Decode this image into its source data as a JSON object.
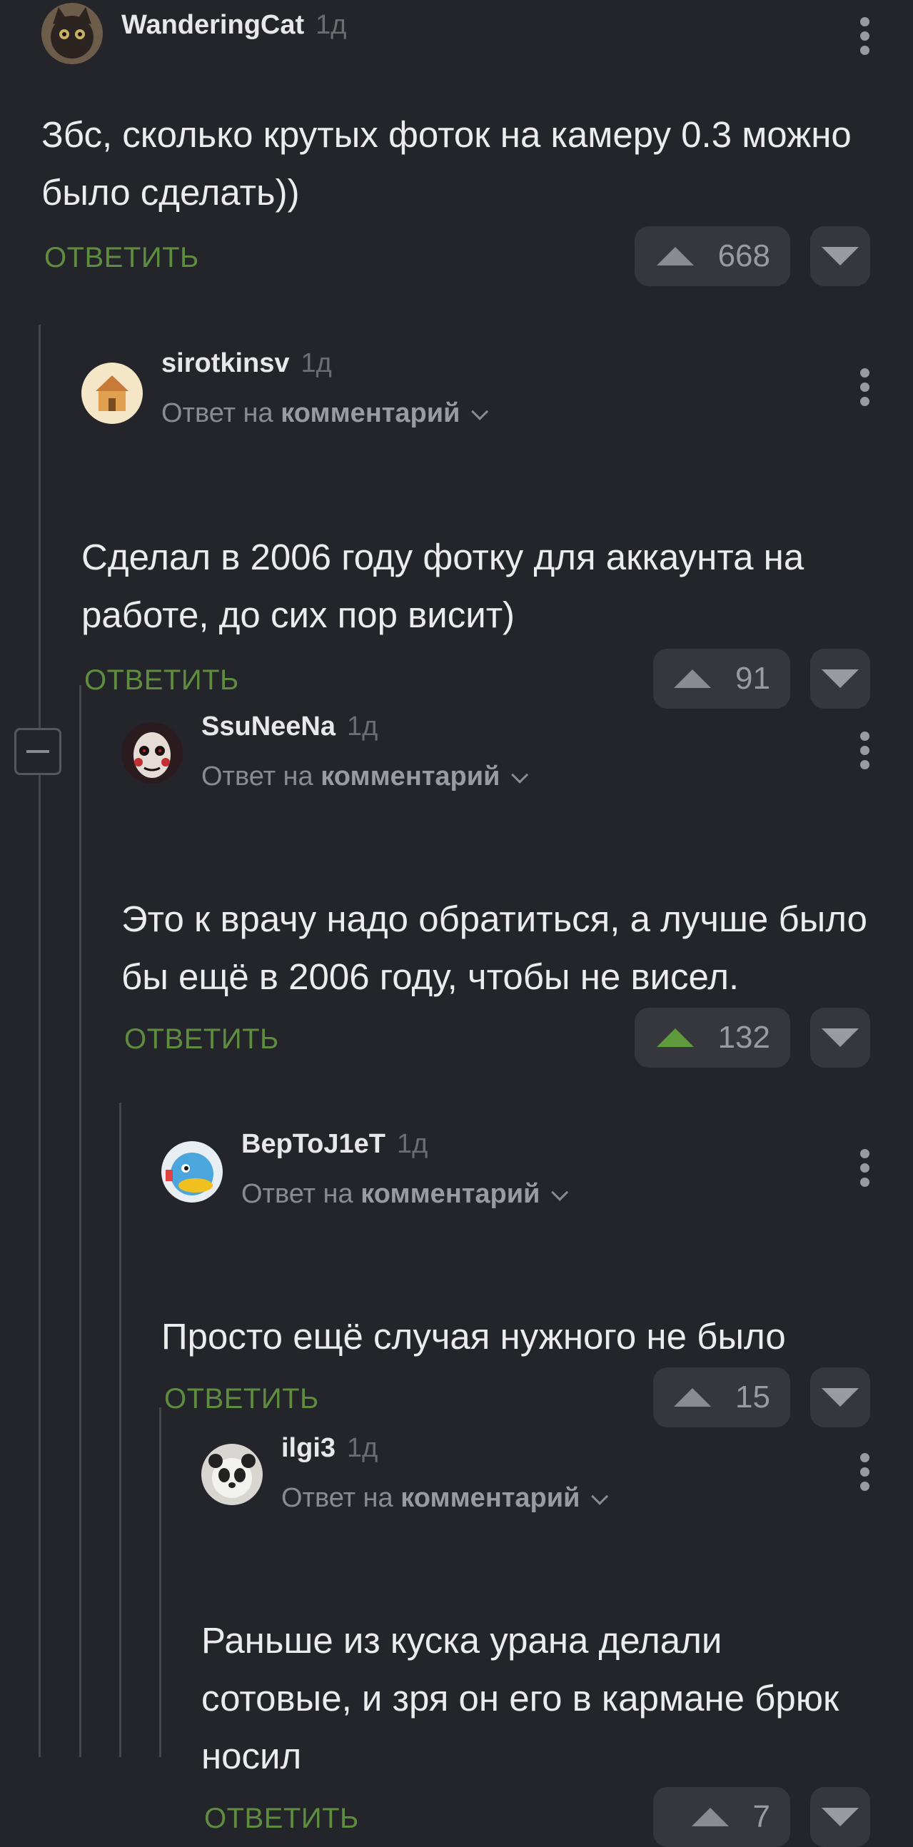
{
  "comments": [
    {
      "author": "WanderingCat",
      "time": "1д",
      "reply_prefix": "",
      "reply_target": "",
      "text": "Збс, сколько крутых фоток на камеру 0.3 можно было сделать))",
      "reply_label": "ОТВЕТИТЬ",
      "votes": "668",
      "upvoted": false,
      "avatar_color": "#6e5c4a"
    },
    {
      "author": "sirotkinsv",
      "time": "1д",
      "reply_prefix": "Ответ на ",
      "reply_target": "комментарий",
      "text": "Сделал в 2006 году фотку для аккаунта на работе, до сих пор висит)",
      "reply_label": "ОТВЕТИТЬ",
      "votes": "91",
      "upvoted": false,
      "avatar_color": "#f2e2c2"
    },
    {
      "author": "SsuNeeNa",
      "time": "1д",
      "reply_prefix": "Ответ на ",
      "reply_target": "комментарий",
      "text": "Это к врачу надо обратиться, а лучше было бы ещё в 2006 году, чтобы не висел.",
      "reply_label": "ОТВЕТИТЬ",
      "votes": "132",
      "upvoted": true,
      "avatar_color": "#3a2628"
    },
    {
      "author": "BepToJ1eT",
      "time": "1д",
      "reply_prefix": "Ответ на ",
      "reply_target": "комментарий",
      "text": "Просто ещё случая нужного не было",
      "reply_label": "ОТВЕТИТЬ",
      "votes": "15",
      "upvoted": false,
      "avatar_color": "#4aa0d8"
    },
    {
      "author": "ilgi3",
      "time": "1д",
      "reply_prefix": "Ответ на ",
      "reply_target": "комментарий",
      "text": "Раньше из куска урана делали сотовые, и зря он его в кармане брюк носил",
      "reply_label": "ОТВЕТИТЬ",
      "votes": "7",
      "upvoted": false,
      "avatar_color": "#d8d8d4"
    }
  ],
  "icons": {
    "upvote": "triangle-up-icon",
    "downvote": "triangle-down-icon",
    "more": "kebab-icon",
    "collapse": "minus-square-icon"
  },
  "colors": {
    "background": "#24252a",
    "reply_green": "#5f8d3f",
    "upvote_active": "#5f9a3c"
  }
}
